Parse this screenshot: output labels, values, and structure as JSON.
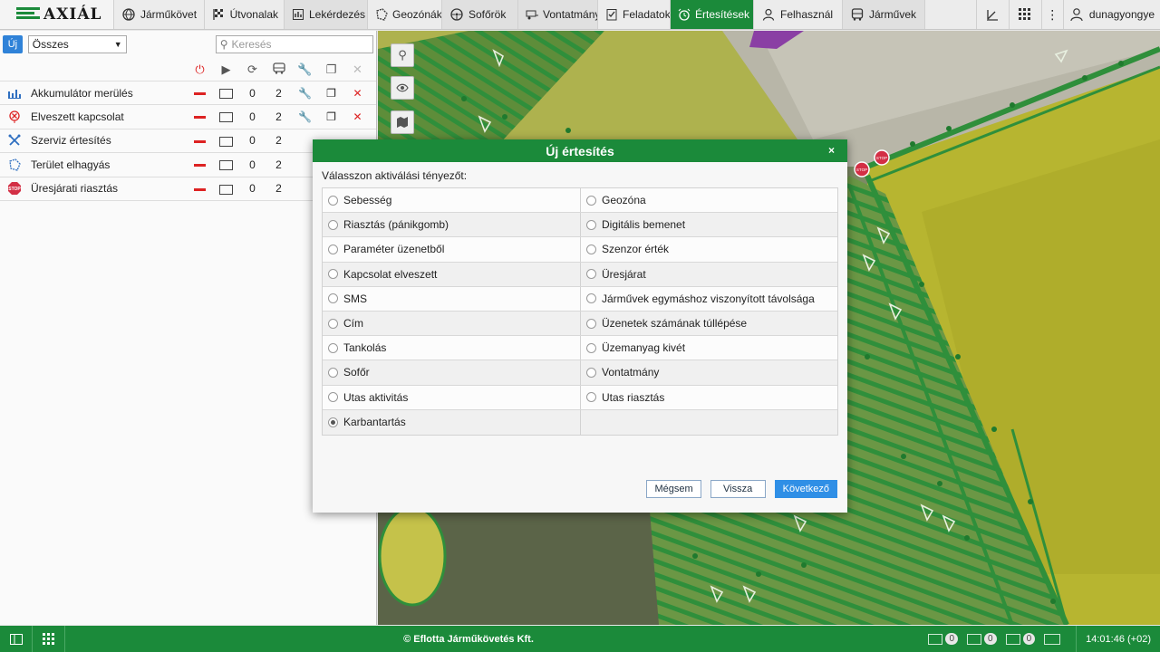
{
  "brand": {
    "name": "AXIÁL"
  },
  "nav": [
    {
      "label": "Járműkövet",
      "icon": "globe-icon"
    },
    {
      "label": "Útvonalak",
      "icon": "checkered-flag-icon"
    },
    {
      "label": "Lekérdezés",
      "icon": "report-icon"
    },
    {
      "label": "Geozónák",
      "icon": "polygon-icon"
    },
    {
      "label": "Sofőrök",
      "icon": "steering-wheel-icon"
    },
    {
      "label": "Vontatmány",
      "icon": "trailer-icon"
    },
    {
      "label": "Feladatok",
      "icon": "checklist-icon"
    },
    {
      "label": "Értesítések",
      "icon": "alarm-clock-icon",
      "active": true
    },
    {
      "label": "Felhasznál",
      "icon": "user-icon"
    },
    {
      "label": "Járművek",
      "icon": "bus-icon"
    }
  ],
  "user": {
    "name": "dunagyongye"
  },
  "left_panel": {
    "new_label": "Új",
    "filter_value": "Összes",
    "search_placeholder": "Keresés",
    "rows": [
      {
        "name": "Akkumulátor merülés",
        "c1": "0",
        "c2": "2"
      },
      {
        "name": "Elveszett kapcsolat",
        "c1": "0",
        "c2": "2"
      },
      {
        "name": "Szerviz értesítés",
        "c1": "0",
        "c2": "2"
      },
      {
        "name": "Terület elhagyás",
        "c1": "0",
        "c2": "2"
      },
      {
        "name": "Üresjárati riasztás",
        "c1": "0",
        "c2": "2"
      }
    ]
  },
  "modal": {
    "title": "Új értesítés",
    "close": "×",
    "prompt": "Válasszon aktiválási tényezőt:",
    "options_left": [
      "Sebesség",
      "Riasztás (pánikgomb)",
      "Paraméter üzenetből",
      "Kapcsolat elveszett",
      "SMS",
      "Cím",
      "Tankolás",
      "Sofőr",
      "Utas aktivitás",
      "Karbantartás"
    ],
    "options_right": [
      "Geozóna",
      "Digitális bemenet",
      "Szenzor érték",
      "Üresjárat",
      "Járművek egymáshoz viszonyított távolsága",
      "Üzenetek számának túllépése",
      "Üzemanyag kivét",
      "Vontatmány",
      "Utas riasztás",
      ""
    ],
    "selected": "Karbantartás",
    "buttons": {
      "cancel": "Mégsem",
      "back": "Vissza",
      "next": "Következő"
    }
  },
  "footer": {
    "copyright": "© Eflotta Járműkövetés Kft.",
    "badges": [
      "0",
      "0",
      "0"
    ],
    "time": "14:01:46 (+02)"
  },
  "map": {
    "stop_label": "STOP"
  }
}
